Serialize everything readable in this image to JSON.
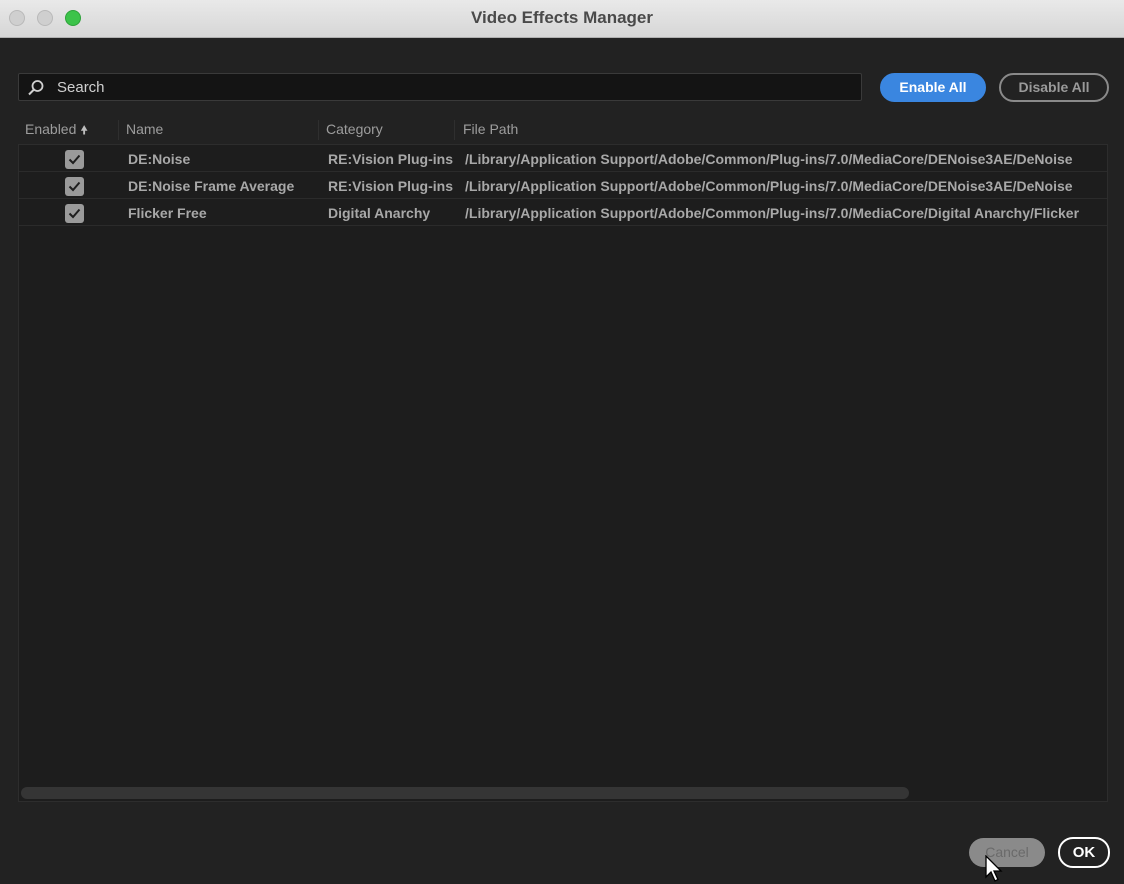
{
  "window": {
    "title": "Video Effects Manager"
  },
  "search": {
    "placeholder": "Search",
    "value": ""
  },
  "toolbar": {
    "enable_all_label": "Enable All",
    "disable_all_label": "Disable All"
  },
  "columns": [
    {
      "label": "Enabled",
      "sort": "ascending"
    },
    {
      "label": "Name"
    },
    {
      "label": "Category"
    },
    {
      "label": "File Path"
    }
  ],
  "rows": [
    {
      "enabled": true,
      "name": "DE:Noise",
      "category": "RE:Vision Plug-ins",
      "file_path": "/Library/Application Support/Adobe/Common/Plug-ins/7.0/MediaCore/DENoise3AE/DeNoise"
    },
    {
      "enabled": true,
      "name": "DE:Noise Frame Average",
      "category": "RE:Vision Plug-ins",
      "file_path": "/Library/Application Support/Adobe/Common/Plug-ins/7.0/MediaCore/DENoise3AE/DeNoise"
    },
    {
      "enabled": true,
      "name": "Flicker Free",
      "category": "Digital Anarchy",
      "file_path": "/Library/Application Support/Adobe/Common/Plug-ins/7.0/MediaCore/Digital Anarchy/Flicker"
    }
  ],
  "footer": {
    "cancel_label": "Cancel",
    "ok_label": "OK"
  },
  "colors": {
    "accent": "#3a86e0",
    "background": "#222222",
    "traffic_zoom": "#3cc34a"
  }
}
